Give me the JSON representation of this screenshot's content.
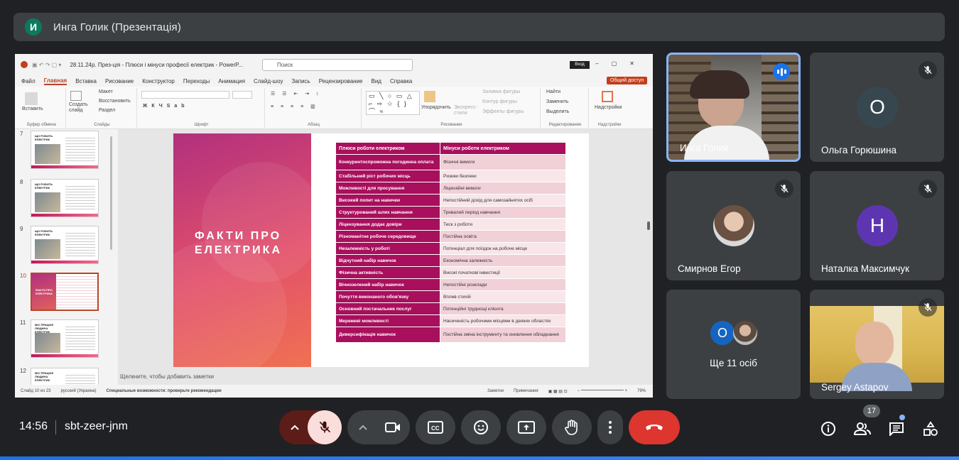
{
  "meeting": {
    "avatar_letter": "И",
    "title": "Инга Голик (Презентація)",
    "time": "14:56",
    "code": "sbt-zeer-jnm",
    "participants_count": "17"
  },
  "powerpoint": {
    "doc_title": "28.11.24р. През-ція - Плюси і мінуси професії електрик - PowerP...",
    "search_placeholder": "Поиск",
    "signin": "Вход",
    "share": "Общий доступ",
    "menu": [
      "Файл",
      "Главная",
      "Вставка",
      "Рисование",
      "Конструктор",
      "Переходы",
      "Анимация",
      "Слайд-шоу",
      "Запись",
      "Рецензирование",
      "Вид",
      "Справка"
    ],
    "ribbon": {
      "paste": "Вставить",
      "clipboard": "Буфер обмена",
      "new_slide": "Создать слайд",
      "layout": "Макет",
      "reset": "Восстановить",
      "section": "Раздел",
      "slides": "Слайды",
      "font": "Шрифт",
      "paragraph": "Абзац",
      "arrange": "Упорядочить",
      "quick_styles": "Экспресс-стили",
      "fill": "Заливка фигуры",
      "outline": "Контур фигуры",
      "effects": "Эффекты фигуры",
      "drawing": "Рисование",
      "find": "Найти",
      "replace": "Заменить",
      "select": "Выделить",
      "editing": "Редактирование",
      "addins": "Надстройки",
      "addins_group": "Надстройки"
    },
    "thumbs": [
      {
        "num": "7",
        "title": "ЩО РОБИТЬ ЕЛЕКТРИК"
      },
      {
        "num": "8",
        "title": "ЩО РОБИТЬ ЕЛЕКТРИК"
      },
      {
        "num": "9",
        "title": "ЩО РОБИТЬ ЕЛЕКТРИК"
      },
      {
        "num": "10",
        "title": "ФАКТИ ПРО ЕЛЕКТРИКА"
      },
      {
        "num": "11",
        "title": "МІС ПРАЦЮЄ ЛЮДИНА ЕЛЕКТРИК"
      },
      {
        "num": "12",
        "title": "МІС ПРАЦЮЄ ЛЮДИНА ЕЛЕКТРИК"
      }
    ],
    "slide": {
      "title": "ФАКТИ ПРО ЕЛЕКТРИКА",
      "table_header": [
        "Плюси роботи електриком",
        "Мінуси роботи електриком"
      ],
      "rows": [
        [
          "Конкурентоспроможна погодинна оплата",
          "Фізичні вимоги"
        ],
        [
          "Стабільний ріст робочих місць",
          "Ризики безпеки"
        ],
        [
          "Можливості для просування",
          "Ліцензійні вимоги"
        ],
        [
          "Високий попит на навички",
          "Непостійний дохід для самозайнятих осіб"
        ],
        [
          "Структурований шлях навчання",
          "Тривалий період навчання"
        ],
        [
          "Ліцензування додає довіри",
          "Тиск з роботи"
        ],
        [
          "Різноманітне робоче середовище",
          "Постійна освіта"
        ],
        [
          "Незалежність у роботі",
          "Потенціал для поїздок на робоче місце"
        ],
        [
          "Відчутний набір навичок",
          "Економічна залежність"
        ],
        [
          "Фізична активність",
          "Високі початкові інвестиції"
        ],
        [
          "Вічнозелений набір навичок",
          "Непостійні розклади"
        ],
        [
          "Почуття виконаного обов'язку",
          "Вплив стихій"
        ],
        [
          "Основний постачальник послуг",
          "Потенційні труднощі клієнта"
        ],
        [
          "Мережеві можливості",
          "Насиченість робочими місцями в деяких областях"
        ],
        [
          "Диверсифікація навичок",
          "Постійна зміна інструменту та оновлення обладнання"
        ]
      ]
    },
    "notes_placeholder": "Щелкните, чтобы добавить заметки",
    "status": {
      "slide": "Слайд 10 из 23",
      "lang": "русский (Украина)",
      "accessibility": "Специальные возможности: проверьте рекомендации",
      "notes": "Заметки",
      "comments": "Примечания",
      "zoom": "79%"
    }
  },
  "participants": [
    {
      "name": "Инга Голик",
      "type": "video"
    },
    {
      "name": "Ольга Горюшина",
      "letter": "О",
      "color": "#37474f"
    },
    {
      "name": "Смирнов Егор",
      "type": "photo"
    },
    {
      "name": "Наталка Максимчук",
      "letter": "Н",
      "color": "#5e35b1"
    },
    {
      "name": "Ще 11 осіб",
      "letter": "О",
      "color": "#1565c0"
    },
    {
      "name": "Sergey Astapov",
      "type": "video"
    }
  ],
  "icons": [
    "mic-off-icon",
    "camera-icon",
    "captions-icon",
    "emoji-icon",
    "present-icon",
    "hand-icon",
    "more-icon",
    "end-call-icon",
    "info-icon",
    "people-icon",
    "chat-icon",
    "activities-icon"
  ]
}
